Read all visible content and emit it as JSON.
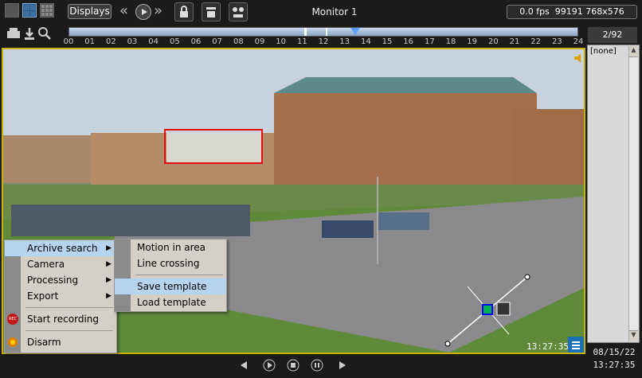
{
  "toolbar": {
    "displays_label": "Displays",
    "monitor_title": "Monitor 1",
    "fps": "0.0 fps",
    "stats": "99191 768x576"
  },
  "timeline": {
    "ticks": [
      "00",
      "01",
      "02",
      "03",
      "04",
      "05",
      "06",
      "07",
      "08",
      "09",
      "10",
      "11",
      "12",
      "13",
      "14",
      "15",
      "16",
      "17",
      "18",
      "19",
      "20",
      "21",
      "22",
      "23",
      "24"
    ],
    "current_hour": 13.5
  },
  "camera_list": {
    "page": "2/92",
    "items": [
      "[none]"
    ]
  },
  "video": {
    "timestamp": "13:27:35"
  },
  "context_menu": {
    "items": [
      {
        "label": "Archive search",
        "submenu": true,
        "highlighted": true
      },
      {
        "label": "Camera",
        "submenu": true
      },
      {
        "label": "Processing",
        "submenu": true
      },
      {
        "label": "Export",
        "submenu": true
      },
      {
        "label": "Start recording",
        "icon": "rec-icon"
      },
      {
        "label": "Disarm",
        "icon": "disarm-icon"
      }
    ],
    "rec_icon_text": "REC"
  },
  "submenu": {
    "items": [
      {
        "label": "Motion in area"
      },
      {
        "label": "Line crossing"
      },
      {
        "label": "Save template",
        "highlighted": true
      },
      {
        "label": "Load template"
      }
    ]
  },
  "status": {
    "date": "08/15/22",
    "time": "13:27:35"
  },
  "colors": {
    "frame_border": "#c8b400",
    "menu_highlight": "#b7d4ee",
    "zone_box": "#e01010"
  }
}
